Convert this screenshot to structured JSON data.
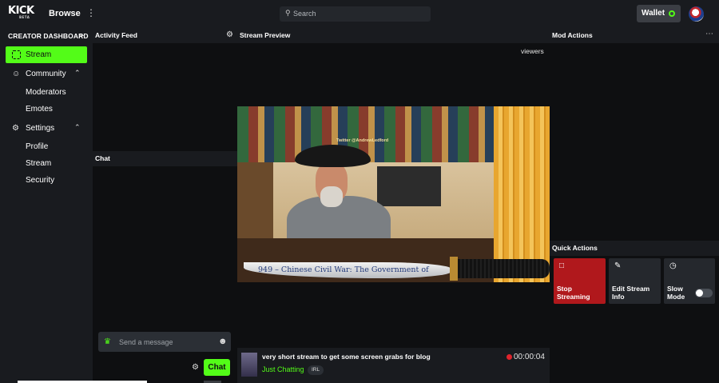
{
  "header": {
    "logo_text": "KICK",
    "logo_sub": "BETA",
    "browse_label": "Browse",
    "more_icon": "kebab-icon",
    "search_placeholder": "Search",
    "wallet_label": "Wallet",
    "accent": "#53fc18"
  },
  "sidebar": {
    "title": "CREATOR DASHBOARD",
    "collapse_icon": "collapse-icon",
    "items": [
      {
        "label": "Stream",
        "icon": "stream-icon",
        "active": true
      },
      {
        "label": "Community",
        "icon": "community-icon",
        "expanded": true,
        "children": [
          {
            "label": "Moderators"
          },
          {
            "label": "Emotes"
          }
        ]
      },
      {
        "label": "Settings",
        "icon": "settings-icon",
        "expanded": true,
        "children": [
          {
            "label": "Profile"
          },
          {
            "label": "Stream"
          },
          {
            "label": "Security"
          }
        ]
      }
    ]
  },
  "activity": {
    "title": "Activity Feed"
  },
  "chat": {
    "title": "Chat",
    "placeholder": "Send a message",
    "send_label": "Chat"
  },
  "preview": {
    "title": "Stream Preview",
    "viewers_label": "viewers",
    "video_overlay_handle": "Twitter @AndrewLedford",
    "video_caption": "949 – Chinese Civil War: The Government of",
    "stream_title": "very short stream to get some screen grabs for blog",
    "category": "Just Chatting",
    "tag": "IRL",
    "elapsed": "00:00:04",
    "live_color": "#e0242c"
  },
  "mod_actions": {
    "title": "Mod Actions"
  },
  "quick_actions": {
    "title": "Quick Actions",
    "cards": [
      {
        "label": "Stop Streaming",
        "icon": "stop-icon",
        "color": "#b0181c"
      },
      {
        "label": "Edit Stream Info",
        "icon": "pencil-icon"
      },
      {
        "label": "Slow Mode",
        "icon": "clock-icon",
        "toggle_on": false
      }
    ]
  }
}
